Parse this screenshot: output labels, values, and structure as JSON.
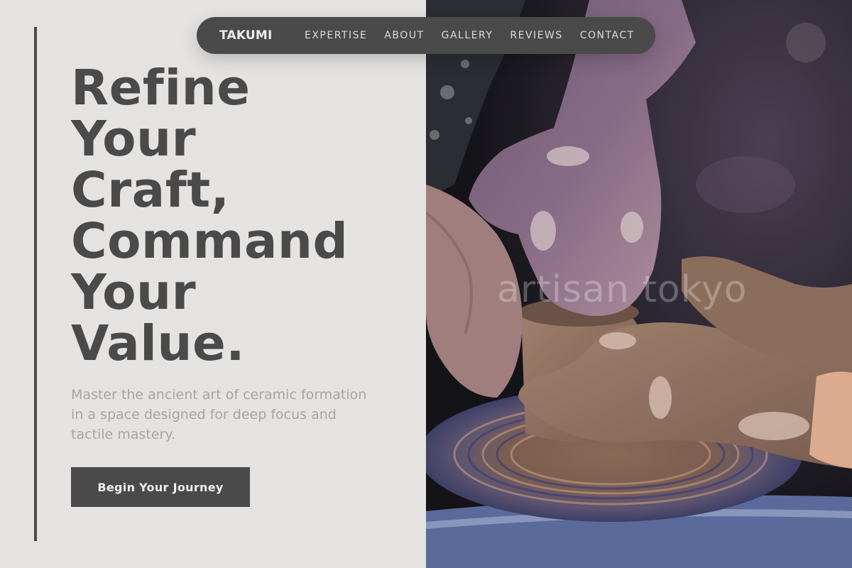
{
  "nav": {
    "brand": "TAKUMI",
    "links": [
      "EXPERTISE",
      "ABOUT",
      "GALLERY",
      "REVIEWS",
      "CONTACT"
    ]
  },
  "hero": {
    "headline_lines": [
      "Refine",
      "Your",
      "Craft,",
      "Command",
      "Your",
      "Value."
    ],
    "subtitle": "Master the ancient art of ceramic formation in a space designed for deep focus and tactile mastery.",
    "cta_label": "Begin Your Journey",
    "watermark": "artisan tokyo"
  },
  "colors": {
    "background": "#e4e3e1",
    "primary_dark": "#4a4a4a",
    "subtitle_gray": "#a5a4a2",
    "clay": "#8e705f"
  },
  "image": {
    "subject": "hands-shaping-clay-on-pottery-wheel"
  }
}
